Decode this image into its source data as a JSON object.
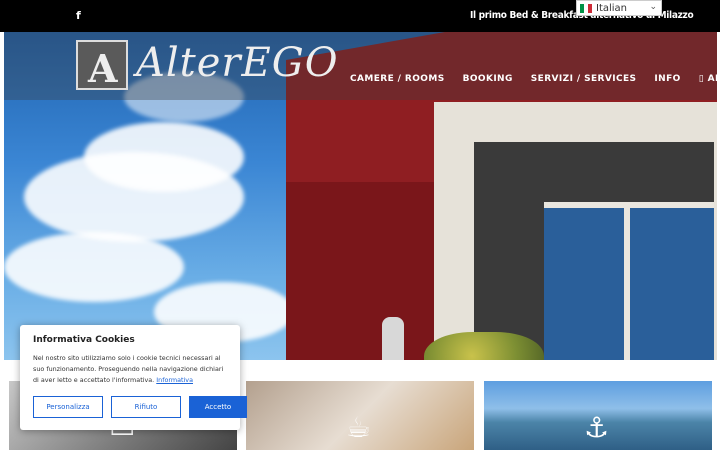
{
  "topbar": {
    "facebook_icon": "facebook-icon",
    "tagline": "Il primo Bed & Breakfast alternativo di Milazzo",
    "language": {
      "label": "Italian",
      "flag": "italy-flag-icon"
    }
  },
  "nav": {
    "logo_mark": "A",
    "logo_text": "AlterEGO",
    "menu": [
      {
        "label": "CAMERE / ROOMS"
      },
      {
        "label": "BOOKING"
      },
      {
        "label": "SERVIZI / SERVICES"
      },
      {
        "label": "INFO"
      },
      {
        "label": "▯ APP"
      }
    ]
  },
  "slider": {
    "slides": 3,
    "active_slide": 1
  },
  "cookie": {
    "title": "Informativa Cookies",
    "text": "Nel nostro sito utilizziamo solo i cookie tecnici necessari al suo funzionamento. Proseguendo nella navigazione dichiari di aver letto e accettato l'informativa.",
    "link": "Informativa",
    "buttons": {
      "customize": "Personalizza",
      "reject": "Rifiuto",
      "accept": "Accetto"
    }
  },
  "tiles": [
    {
      "icon": "bed-icon"
    },
    {
      "icon": "coffee-cup-icon"
    },
    {
      "icon": "anchor-icon"
    }
  ],
  "colors": {
    "accent": "#1a62d6",
    "active_dot": "#e74c3c",
    "topbar": "#000000"
  }
}
